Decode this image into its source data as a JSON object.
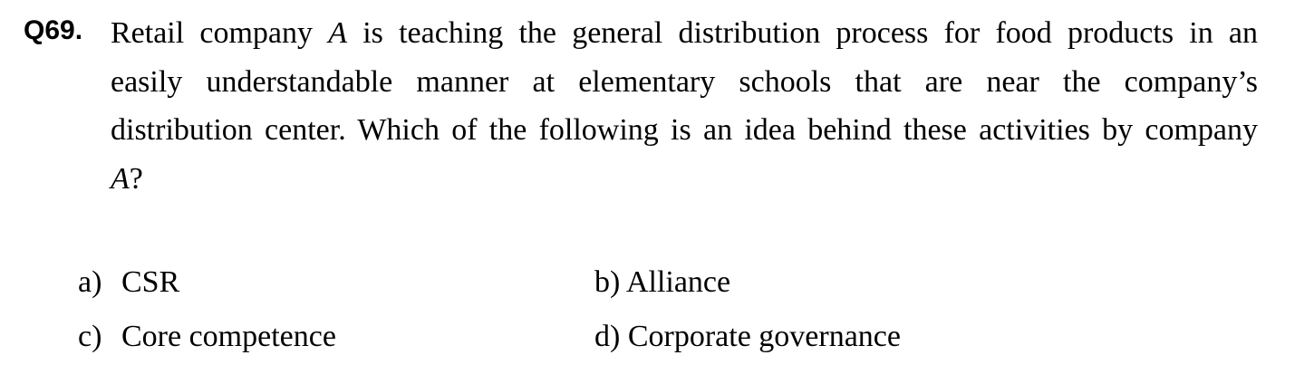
{
  "question": {
    "number": "Q69.",
    "lines": [
      {
        "pre": "Retail company ",
        "em": "A",
        "post": " is teaching the general distribution process for food products in an"
      },
      {
        "pre": "easily understandable manner at elementary schools that are near the company’s",
        "em": "",
        "post": ""
      },
      {
        "pre": "distribution center. Which of the following is an idea behind these activities by company",
        "em": "",
        "post": ""
      },
      {
        "pre": "",
        "em": "A",
        "post": "?"
      }
    ]
  },
  "options": [
    {
      "letter": "a)",
      "text": "CSR"
    },
    {
      "letter": "b)",
      "text": "Alliance"
    },
    {
      "letter": "c)",
      "text": "Core competence"
    },
    {
      "letter": "d)",
      "text": "Corporate governance"
    }
  ]
}
